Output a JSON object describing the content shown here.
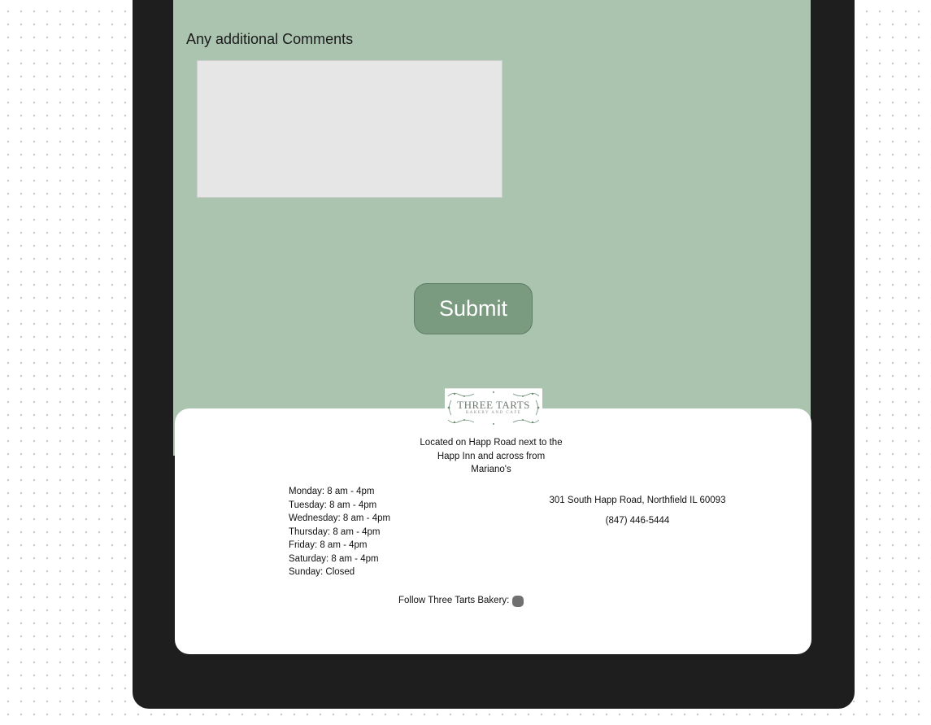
{
  "form": {
    "comments_label": "Any additional Comments",
    "comments_value": "",
    "submit_label": "Submit"
  },
  "footer": {
    "logo": {
      "name": "THREE TARTS",
      "tagline": "BAKERY AND CAFE"
    },
    "location": "Located on Happ Road next to the Happ Inn and across from Mariano's",
    "hours": [
      "Monday: 8 am - 4pm",
      "Tuesday: 8 am - 4pm",
      "Wednesday: 8 am - 4pm",
      "Thursday: 8 am - 4pm",
      "Friday: 8 am - 4pm",
      "Saturday: 8 am - 4pm",
      "Sunday: Closed"
    ],
    "address": "301 South Happ Road, Northfield IL 60093",
    "phone": "(847) 446-5444",
    "follow_label": "Follow Three Tarts Bakery:",
    "social_icon": "social-icon"
  },
  "colors": {
    "device_frame": "#1e1e1e",
    "screen_background": "#aac4af",
    "button_background": "#7a9b80",
    "textarea_background": "#e6e6e6",
    "footer_background": "#ffffff"
  }
}
